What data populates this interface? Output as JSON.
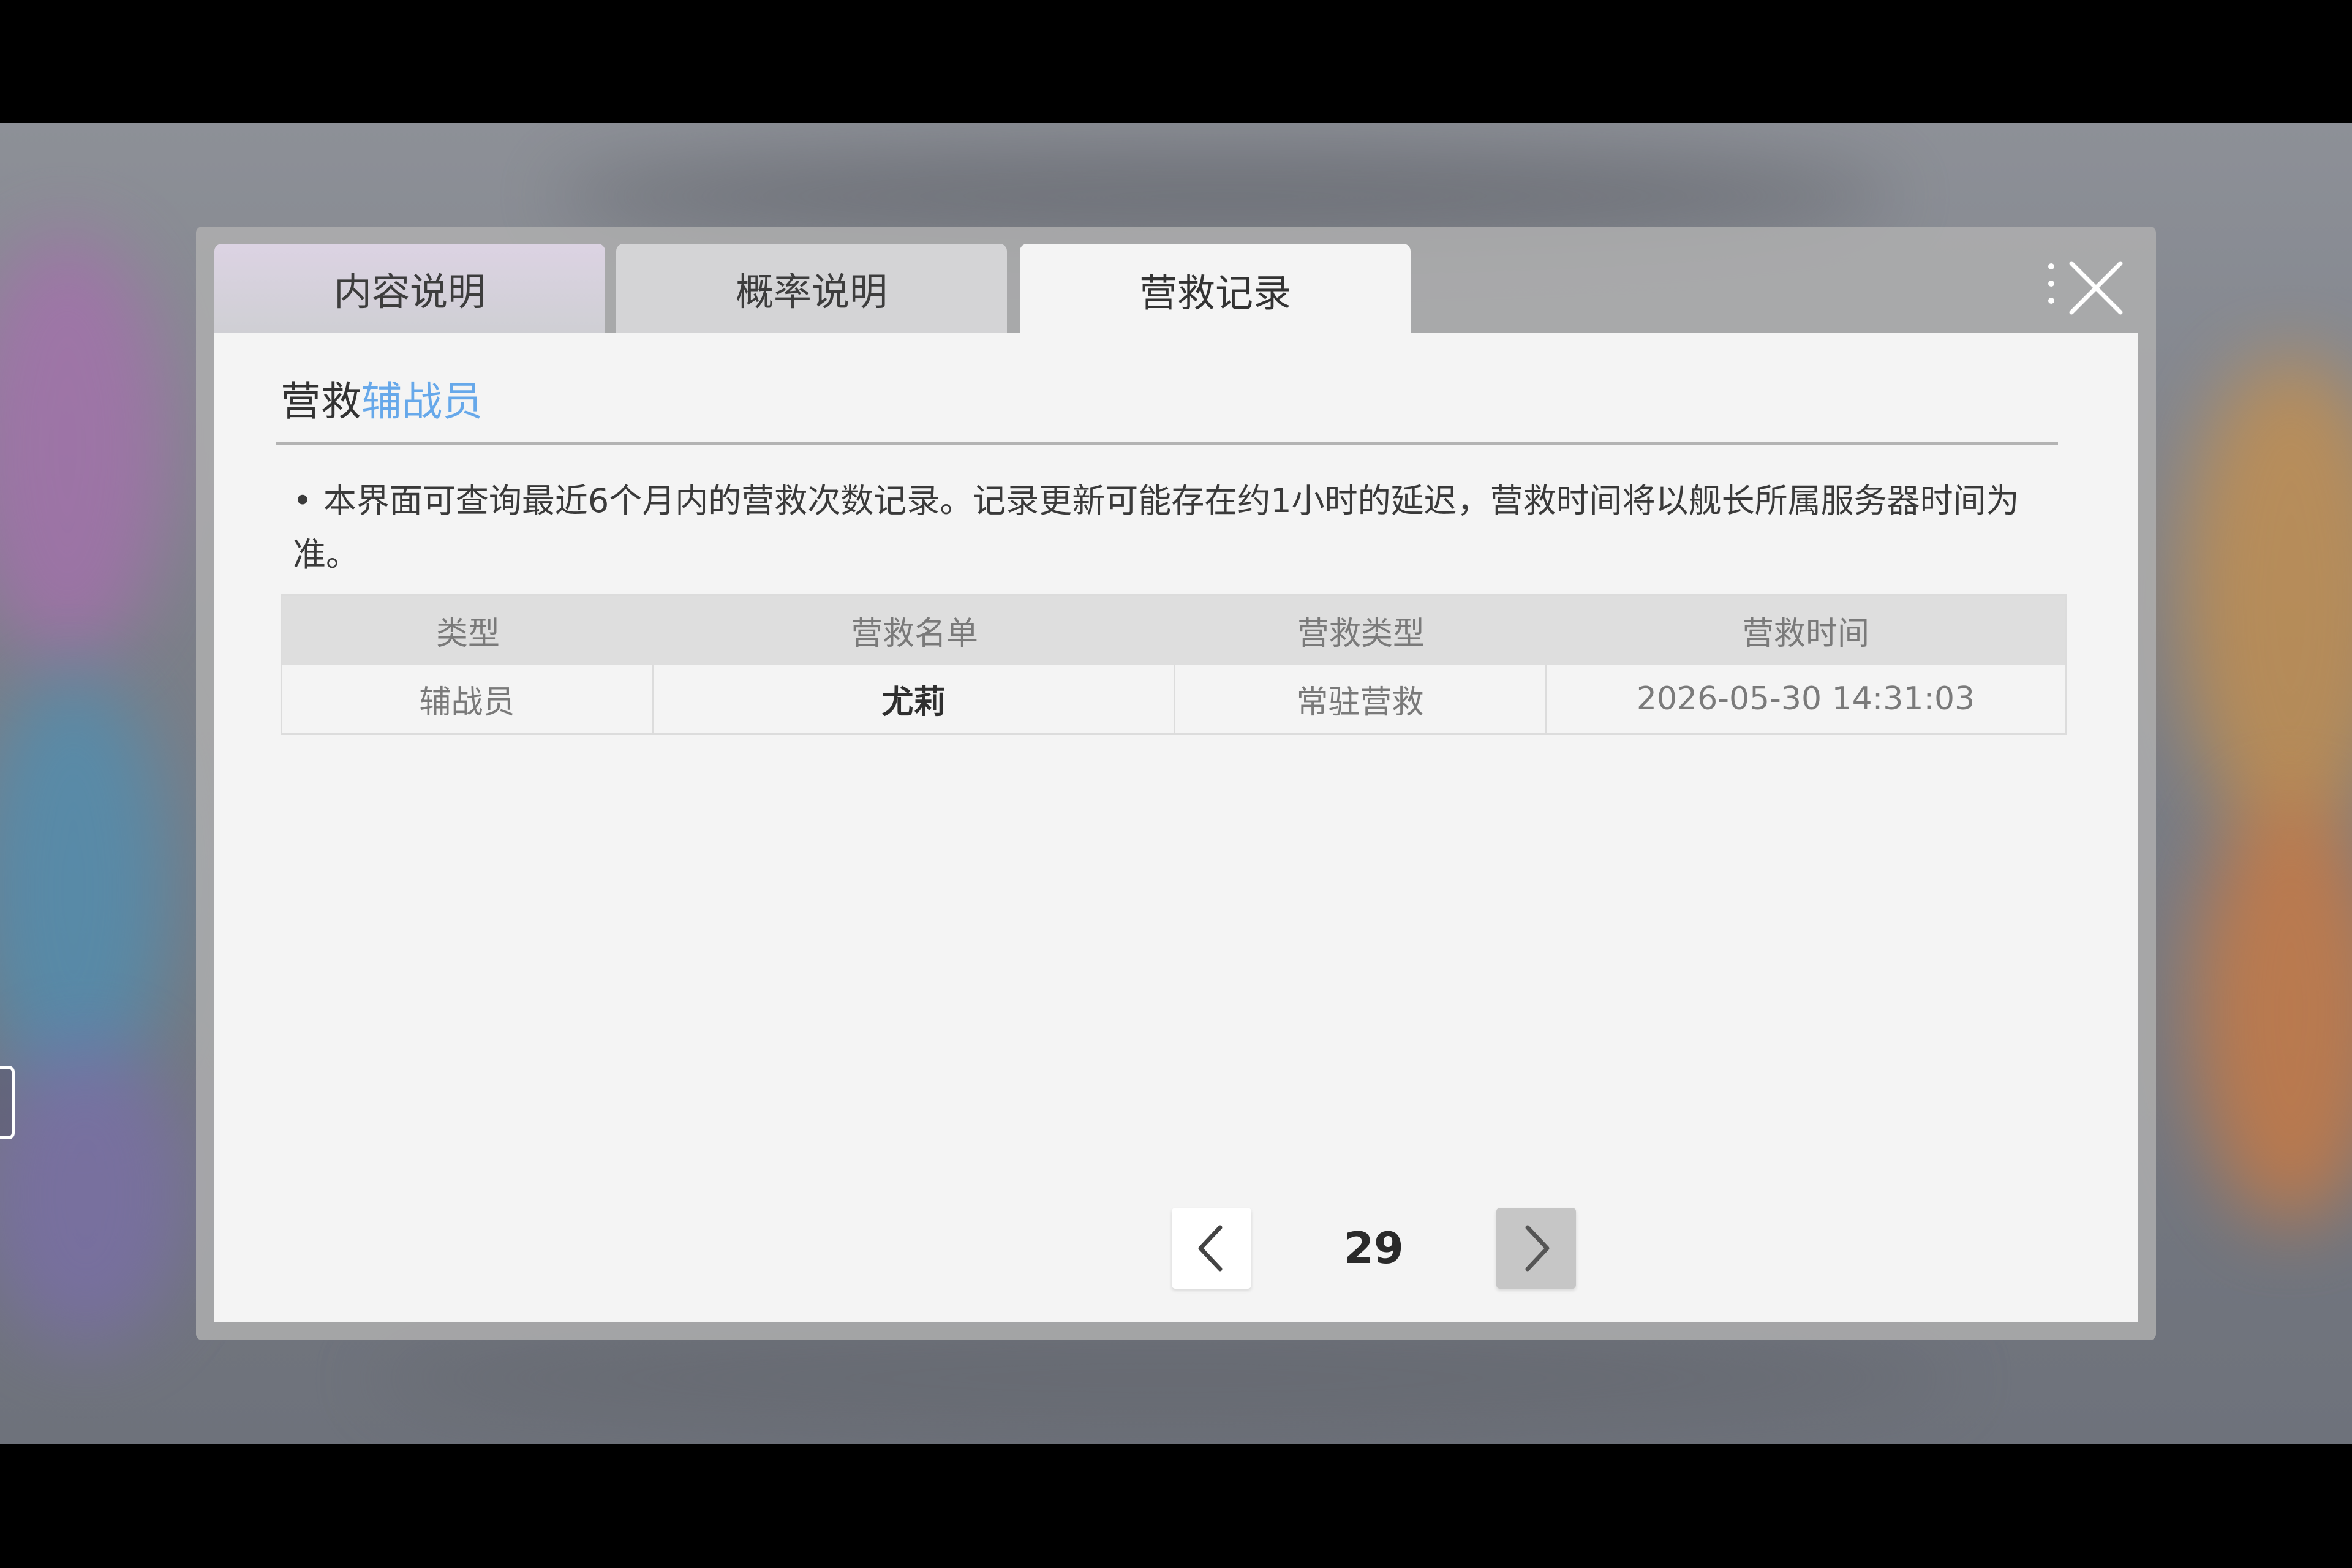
{
  "tabs": [
    {
      "label": "内容说明"
    },
    {
      "label": "概率说明"
    },
    {
      "label": "营救记录"
    }
  ],
  "active_tab": "营救记录",
  "section": {
    "title_main": "营救",
    "title_accent": "辅战员"
  },
  "notice": {
    "bullet": "•",
    "text": "本界面可查询最近6个月内的营救次数记录。记录更新可能存在约1小时的延迟，营救时间将以舰长所属服务器时间为准。"
  },
  "table": {
    "headers": [
      "类型",
      "营救名单",
      "营救类型",
      "营救时间"
    ],
    "rows": [
      [
        "辅战员",
        "尤莉",
        "常驻营救",
        "2026-05-30 14:31:03"
      ]
    ]
  },
  "pagination": {
    "page": "29"
  },
  "icons": {
    "close": "close-icon",
    "more": "more-dots-icon",
    "prev": "chevron-left-icon",
    "next": "chevron-right-icon"
  },
  "colors": {
    "accent": "#66a8ea",
    "panel_bg": "#f4f4f4"
  }
}
